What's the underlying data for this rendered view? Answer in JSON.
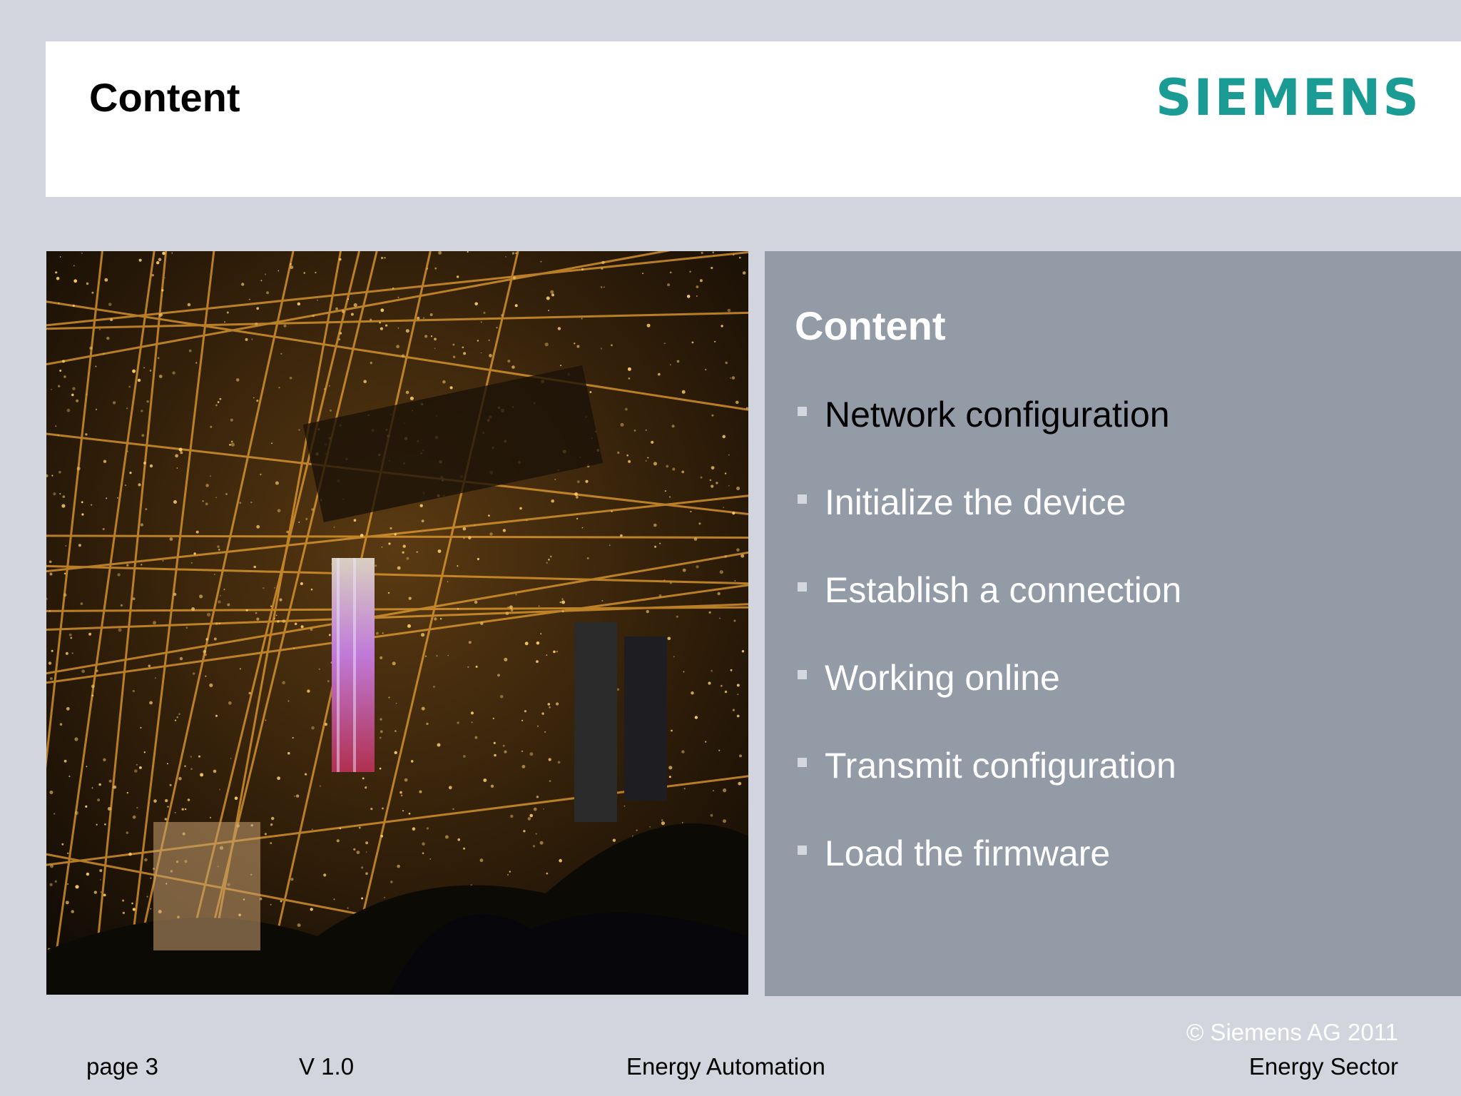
{
  "header": {
    "title": "Content",
    "logo_text": "SIEMENS"
  },
  "photo": {
    "description_icon": "city-night-aerial-photo"
  },
  "panel": {
    "title": "Content",
    "items": [
      "Network configuration",
      "Initialize the device",
      "Establish a connection",
      "Working online",
      "Transmit configuration",
      "Load the firmware"
    ]
  },
  "footer": {
    "page": "page 3",
    "version": "V 1.0",
    "center": "Energy Automation",
    "copyright": "© Siemens AG 2011",
    "sector": "Energy Sector"
  },
  "colors": {
    "brand": "#1a9c95",
    "background": "#d2d5dd",
    "panel": "#939ba6"
  }
}
